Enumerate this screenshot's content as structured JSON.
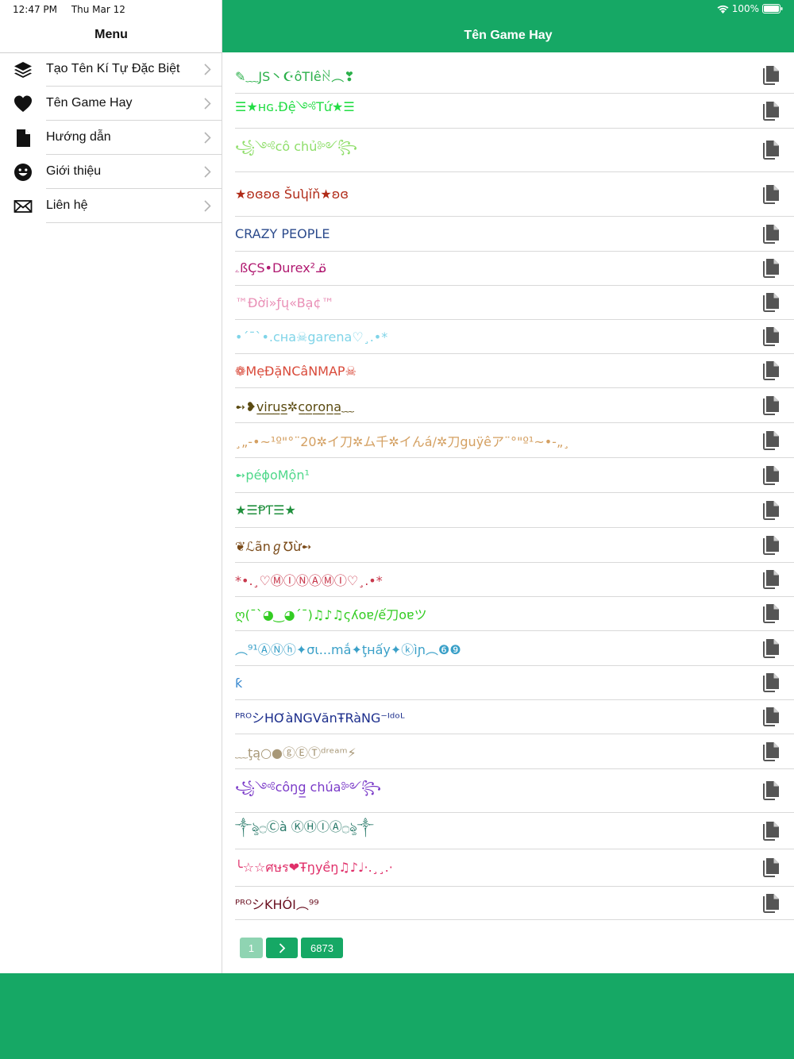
{
  "status": {
    "time": "12:47 PM",
    "date": "Thu Mar 12",
    "battery": "100%"
  },
  "menu": {
    "title": "Menu",
    "items": [
      {
        "label": "Tạo Tên Kí Tự Đặc Biệt",
        "icon": "layers-icon"
      },
      {
        "label": "Tên Game Hay",
        "icon": "heart-icon"
      },
      {
        "label": "Hướng dẫn",
        "icon": "document-icon"
      },
      {
        "label": "Giới thiệu",
        "icon": "smiley-icon"
      },
      {
        "label": "Liên hệ",
        "icon": "envelope-icon"
      }
    ]
  },
  "main": {
    "title": "Tên Game Hay",
    "names": [
      {
        "text": "✎﹏JS丶☪ôTIêꋊ︵❣",
        "color": "#2bb04a"
      },
      {
        "text": "☰★ʜɢ.Đệ༺Tứ★☰",
        "color": "#22dd44"
      },
      {
        "text": "꧁༺cô chủ༻꧂",
        "color": "#8fde6a"
      },
      {
        "text": "★ʚɞʚɞ Šuʮǐň★ʚɞ",
        "color": "#b02a17"
      },
      {
        "text": "CRAZY PEOPLE",
        "color": "#2c4b8c"
      },
      {
        "text": "ۦßÇS•Durex²ᓆ",
        "color": "#b01870"
      },
      {
        "text": "™Đời»ƒų«Bạ¢™",
        "color": "#e98fb6"
      },
      {
        "text": "•´¯`•.cʜa☠garena♡¸.•*",
        "color": "#7fd4e8"
      },
      {
        "text": "❁MẹĐặNCâNMAP☠",
        "color": "#d94a3a"
      },
      {
        "text": "➻❥v̲i̲r̲u̲s̲✲c̲o̲r̲o̲n̲a̲﹏",
        "color": "#5a4a10"
      },
      {
        "text": "¸„-•~¹º\"°¨20✲イ刀✲ム千✲イんá/✲刀guÿêア¨°\"º¹~•-„¸",
        "color": "#d4a062"
      },
      {
        "text": "➻péɸoMộn¹",
        "color": "#4fd88a"
      },
      {
        "text": "★☰ⱣƬ☰★",
        "color": "#1f8f3c"
      },
      {
        "text": "❦ℒãnℊ℧ừ➻",
        "color": "#7a4a18"
      },
      {
        "text": "*•.¸♡ⓂⒾⓃⒶⓂⒾ♡¸.•*",
        "color": "#c8384c"
      },
      {
        "text": "ღ(¯`◕‿◕´¯)♫♪♫ςʎoɐ/ế刀oɐツ",
        "color": "#33cc22"
      },
      {
        "text": "︵⁹¹ⒶⓃⓗ✦σι...mắ✦ţʜấy✦ⓚìɲ︵❻❾",
        "color": "#3aa0c8"
      },
      {
        "text": "ƙ",
        "color": "#3a8ad0"
      },
      {
        "text": "ᴾᴿᴼシHƠàNGVănŦRàNG⁻ᴵᵈᵒᴸ",
        "color": "#1c2e8c"
      },
      {
        "text": "﹏ţą○●ⓖⒺⓉᵈʳᵉᵃᵐ⚡",
        "color": "#a89878"
      },
      {
        "text": "꧁༺côŋg̲̲ chúa༻꧂",
        "color": "#7a3ac8"
      },
      {
        "text": "༒ৡ۝Ⓒà ⓀⒽⒾⒶ۝ৡ༒",
        "color": "#2a7a6a"
      },
      {
        "text": "╰☆☆ศษร❤Ŧŋyềŋ♫♪♩·.¸¸.·",
        "color": "#e0306a"
      },
      {
        "text": "ᴾᴿᴼシKHÓI︵⁹⁹",
        "color": "#6a1020"
      }
    ]
  },
  "pager": {
    "current": "1",
    "last": "6873"
  },
  "colors": {
    "brand": "#16a865",
    "pager_disabled": "#8fd4b2"
  }
}
